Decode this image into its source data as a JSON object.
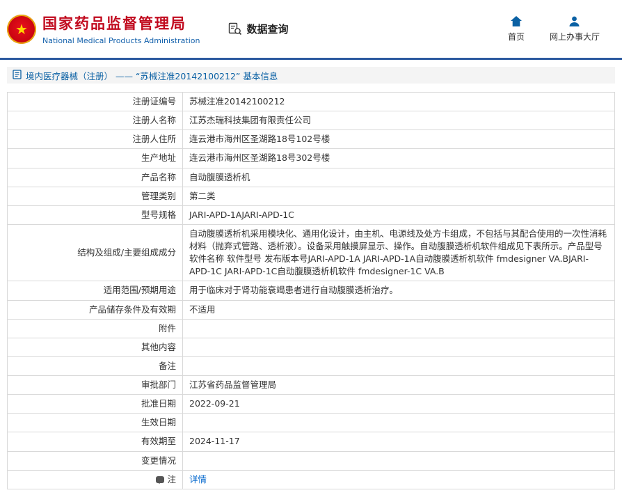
{
  "header": {
    "org_name_cn": "国家药品监督管理局",
    "org_name_en": "National Medical Products Administration",
    "data_query_label": "数据查询",
    "nav": [
      {
        "label": "首页",
        "icon": "home-icon"
      },
      {
        "label": "网上办事大厅",
        "icon": "user-icon"
      }
    ]
  },
  "colors": {
    "brand_red": "#c10a1e",
    "link_blue": "#0066cc",
    "divider_blue": "#2c5aa0",
    "breadcrumb_bg": "#f4f4f4",
    "table_border": "#d9d9d9"
  },
  "breadcrumb": {
    "text": "境内医疗器械（注册） —— “苏械注准20142100212” 基本信息"
  },
  "table": {
    "rows": [
      {
        "key": "reg-cert-no",
        "label": "注册证编号",
        "value": "苏械注准20142100212"
      },
      {
        "key": "registrant-name",
        "label": "注册人名称",
        "value": "江苏杰瑞科技集团有限责任公司"
      },
      {
        "key": "registrant-address",
        "label": "注册人住所",
        "value": "连云港市海州区圣湖路18号102号楼"
      },
      {
        "key": "production-address",
        "label": "生产地址",
        "value": "连云港市海州区圣湖路18号302号楼"
      },
      {
        "key": "product-name",
        "label": "产品名称",
        "value": "自动腹膜透析机"
      },
      {
        "key": "management-class",
        "label": "管理类别",
        "value": "第二类"
      },
      {
        "key": "model-spec",
        "label": "型号规格",
        "value": "JARI-APD-1AJARI-APD-1C"
      },
      {
        "key": "structure-composition",
        "label": "结构及组成/主要组成成分",
        "value": "自动腹膜透析机采用模块化、通用化设计，由主机、电源线及处方卡组成，不包括与其配合使用的一次性消耗材料（抛弃式管路、透析液）。设备采用触摸屏显示、操作。自动腹膜透析机软件组成见下表所示。产品型号 软件名称 软件型号 发布版本号JARI-APD-1A JARI-APD-1A自动腹膜透析机软件 fmdesigner VA.BJARI-APD-1C JARI-APD-1C自动腹膜透析机软件 fmdesigner-1C VA.B"
      },
      {
        "key": "intended-use",
        "label": "适用范围/预期用途",
        "value": "用于临床对于肾功能衰竭患者进行自动腹膜透析治疗。"
      },
      {
        "key": "storage-validity",
        "label": "产品储存条件及有效期",
        "value": "不适用"
      },
      {
        "key": "attachment",
        "label": "附件",
        "value": ""
      },
      {
        "key": "other-content",
        "label": "其他内容",
        "value": ""
      },
      {
        "key": "remark",
        "label": "备注",
        "value": ""
      },
      {
        "key": "approval-dept",
        "label": "审批部门",
        "value": "江苏省药品监督管理局"
      },
      {
        "key": "approval-date",
        "label": "批准日期",
        "value": "2022-09-21"
      },
      {
        "key": "effective-date",
        "label": "生效日期",
        "value": ""
      },
      {
        "key": "valid-until",
        "label": "有效期至",
        "value": "2024-11-17"
      },
      {
        "key": "change-status",
        "label": "变更情况",
        "value": ""
      },
      {
        "key": "note",
        "label": "注",
        "value": "详情",
        "icon": "note-bubble-icon",
        "link": true
      }
    ]
  }
}
